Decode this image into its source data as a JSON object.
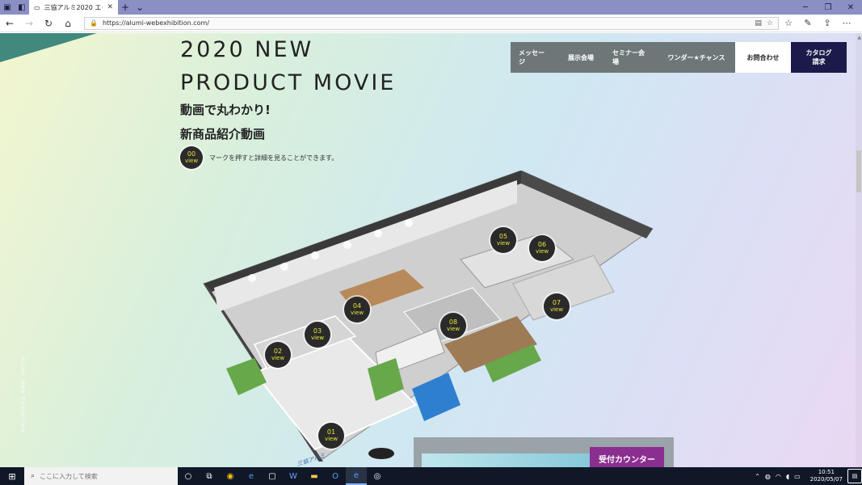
{
  "browser": {
    "tab": {
      "title": "三協アルミ2020 エクステリ",
      "close": "✕"
    },
    "new_tab": "+",
    "tab_menu": "⌄",
    "url": "https://alumi-webexhibition.com/",
    "window_controls": {
      "minimize": "─",
      "restore": "❐",
      "close": "✕"
    }
  },
  "hero": {
    "title_line1": "2020 NEW",
    "title_line2": "PRODUCT MOVIE",
    "jp_line1": "動画で丸わかり!",
    "jp_line2": "新商品紹介動画",
    "legend_marker_num": "00",
    "legend_marker_label": "view",
    "legend_text": "マークを押すと詳細を見ることができます。"
  },
  "side_text": "Alumi Web Exhibition",
  "site_nav": {
    "items": [
      "メッセージ",
      "展示会場",
      "セミナー会場",
      "ワンダー★チャンス"
    ],
    "contact": "お問合わせ",
    "catalog": "カタログ\n請求"
  },
  "markers": [
    {
      "num": "01",
      "label": "view"
    },
    {
      "num": "02",
      "label": "view"
    },
    {
      "num": "03",
      "label": "view"
    },
    {
      "num": "04",
      "label": "view"
    },
    {
      "num": "05",
      "label": "view"
    },
    {
      "num": "06",
      "label": "view"
    },
    {
      "num": "07",
      "label": "view"
    },
    {
      "num": "08",
      "label": "view"
    }
  ],
  "floorplan_sign": "三協アルミ",
  "reception_label": "受付カウンター",
  "taskbar": {
    "search_placeholder": "ここに入力して検索",
    "time": "10:51",
    "date": "2020/05/07"
  },
  "colors": {
    "tab_bar": "#8a8fc4",
    "nav_gray": "#6e7778",
    "catalog_navy": "#1c1a4a",
    "marker_yellow": "#e8e43a",
    "reception_purple": "#8a2e8f"
  }
}
